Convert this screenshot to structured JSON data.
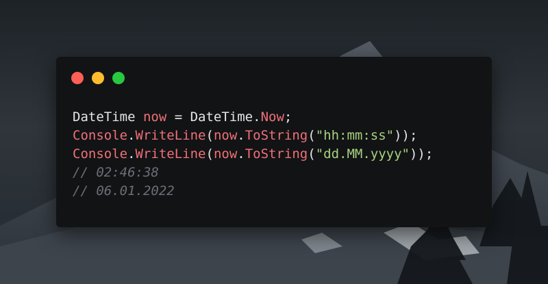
{
  "colors": {
    "window_background": "#121315",
    "close": "#ff5f57",
    "minimize": "#febc2e",
    "maximize": "#28c840",
    "plain_text": "#e6e6e6",
    "keyword": "#f07178",
    "string": "#a7d27e",
    "comment": "#6b6f76"
  },
  "window": {
    "buttons": [
      {
        "name": "close",
        "color": "#ff5f57"
      },
      {
        "name": "minimize",
        "color": "#febc2e"
      },
      {
        "name": "maximize",
        "color": "#28c840"
      }
    ]
  },
  "code": {
    "lines": [
      {
        "tokens": [
          {
            "text": "DateTime ",
            "kind": "plain"
          },
          {
            "text": "now",
            "kind": "keyword"
          },
          {
            "text": " = DateTime.",
            "kind": "plain"
          },
          {
            "text": "Now",
            "kind": "keyword"
          },
          {
            "text": ";",
            "kind": "plain"
          }
        ]
      },
      {
        "tokens": [
          {
            "text": "Console",
            "kind": "keyword"
          },
          {
            "text": ".",
            "kind": "plain"
          },
          {
            "text": "WriteLine",
            "kind": "keyword"
          },
          {
            "text": "(",
            "kind": "plain"
          },
          {
            "text": "now",
            "kind": "keyword"
          },
          {
            "text": ".",
            "kind": "plain"
          },
          {
            "text": "ToString",
            "kind": "keyword"
          },
          {
            "text": "(",
            "kind": "plain"
          },
          {
            "text": "\"hh:mm:ss\"",
            "kind": "string"
          },
          {
            "text": "));",
            "kind": "plain"
          }
        ]
      },
      {
        "tokens": [
          {
            "text": "Console",
            "kind": "keyword"
          },
          {
            "text": ".",
            "kind": "plain"
          },
          {
            "text": "WriteLine",
            "kind": "keyword"
          },
          {
            "text": "(",
            "kind": "plain"
          },
          {
            "text": "now",
            "kind": "keyword"
          },
          {
            "text": ".",
            "kind": "plain"
          },
          {
            "text": "ToString",
            "kind": "keyword"
          },
          {
            "text": "(",
            "kind": "plain"
          },
          {
            "text": "\"dd.MM.yyyy\"",
            "kind": "string"
          },
          {
            "text": "));",
            "kind": "plain"
          }
        ]
      },
      {
        "tokens": [
          {
            "text": "// 02:46:38",
            "kind": "comment"
          }
        ]
      },
      {
        "tokens": [
          {
            "text": "// 06.01.2022",
            "kind": "comment"
          }
        ]
      }
    ]
  }
}
